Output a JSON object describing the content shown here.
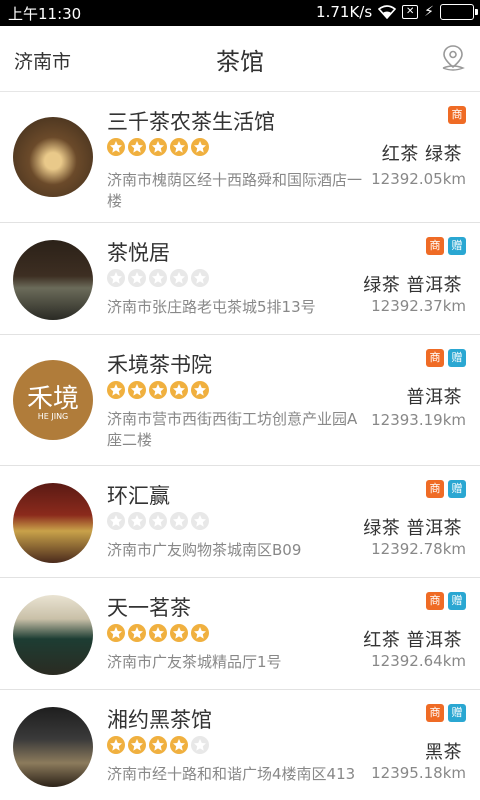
{
  "status_bar": {
    "time": "上午11:30",
    "speed": "1.71K/s"
  },
  "header": {
    "city": "济南市",
    "title": "茶馆",
    "location_icon": "location-pin-icon"
  },
  "badge_labels": {
    "shang": "商",
    "zeng": "赠"
  },
  "colors": {
    "star_on": "#f0b03f",
    "star_off": "#e8e8e8",
    "badge_shang": "#ef6b25",
    "badge_zeng": "#2aa7d2"
  },
  "shops": [
    {
      "name": "三千茶农茶生活馆",
      "rating": 5,
      "tags": "红茶 绿茶",
      "address": "济南市槐荫区经十西路舜和国际酒店一楼",
      "distance": "12392.05km",
      "badges": [
        "shang"
      ]
    },
    {
      "name": "茶悦居",
      "rating": 0,
      "tags": "绿茶 普洱茶",
      "address": "济南市张庄路老屯茶城5排13号",
      "distance": "12392.37km",
      "badges": [
        "shang",
        "zeng"
      ]
    },
    {
      "name": "禾境茶书院",
      "rating": 5,
      "tags": "普洱茶",
      "address": "济南市营市西街西街工坊创意产业园A座二楼",
      "distance": "12393.19km",
      "badges": [
        "shang",
        "zeng"
      ],
      "logo_text": "禾境",
      "logo_sub": "HE JING"
    },
    {
      "name": "环汇赢",
      "rating": 0,
      "tags": "绿茶 普洱茶",
      "address": "济南市广友购物茶城南区B09",
      "distance": "12392.78km",
      "badges": [
        "shang",
        "zeng"
      ]
    },
    {
      "name": "天一茗茶",
      "rating": 5,
      "tags": "红茶 普洱茶",
      "address": "济南市广友茶城精品厅1号",
      "distance": "12392.64km",
      "badges": [
        "shang",
        "zeng"
      ]
    },
    {
      "name": "湘约黑茶馆",
      "rating": 4,
      "tags": "黑茶",
      "address": "济南市经十路和和谐广场4楼南区413",
      "distance": "12395.18km",
      "badges": [
        "shang",
        "zeng"
      ]
    }
  ]
}
